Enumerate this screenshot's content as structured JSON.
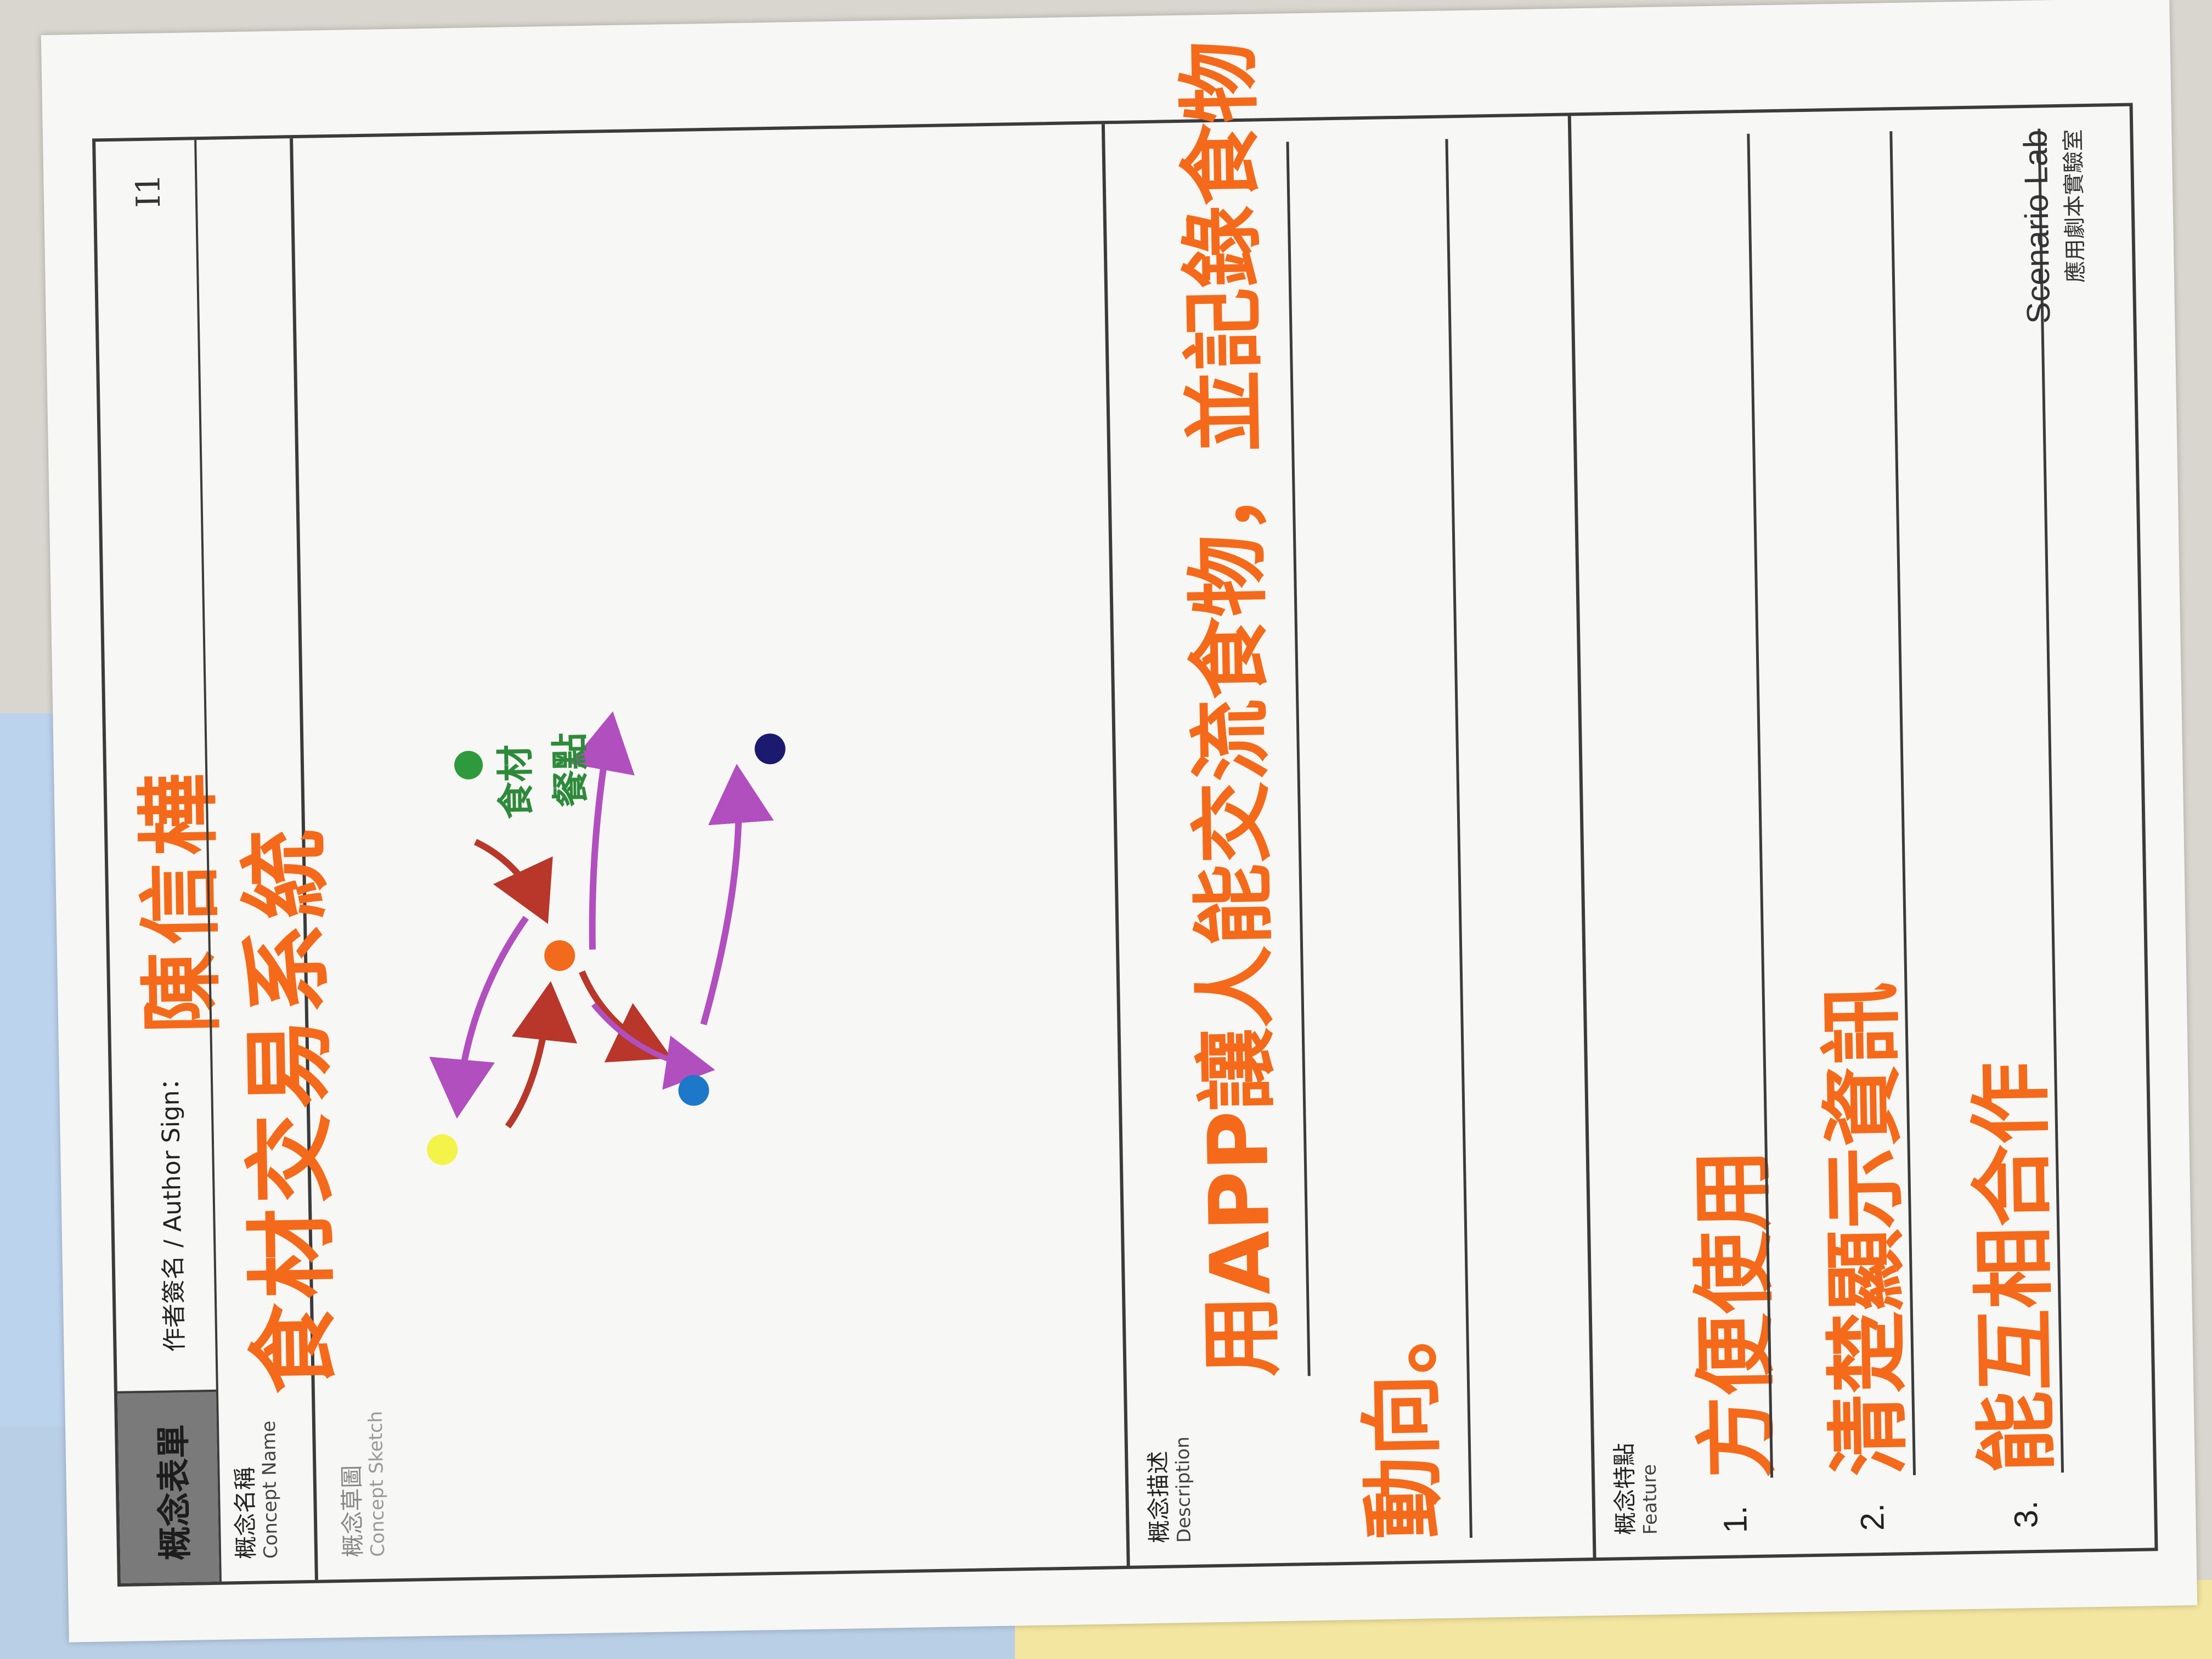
{
  "form": {
    "title": "概念表單",
    "author_label": "作者簽名 / Author Sign：",
    "author_name": "陳信樺",
    "page_code": "I1"
  },
  "concept_name": {
    "label_zh": "概念名稱",
    "label_en": "Concept Name",
    "value": "食材交易系統"
  },
  "sketch": {
    "label_zh": "概念草圖",
    "label_en": "Concept Sketch",
    "note_ingredients": "食材",
    "note_meeting_point": "餐點"
  },
  "description": {
    "label_zh": "概念描述",
    "label_en": "Description",
    "line1": "用APP讓人能交流食物，並記錄食物",
    "line2": "動向。"
  },
  "features": {
    "label_zh": "概念特點",
    "label_en": "Feature",
    "items": [
      {
        "num": "1.",
        "text": "方便使用"
      },
      {
        "num": "2.",
        "text": "清楚顯示資訊"
      },
      {
        "num": "3.",
        "text": "能互相合作"
      }
    ]
  },
  "brand": {
    "name": "Scenario Lab",
    "subtitle": "應用劇本實驗室"
  },
  "colors": {
    "ink_orange": "#f46a1a",
    "dot_orange": "#f26a1b",
    "dot_green": "#2e9a3c",
    "dot_yellow": "#f4f34a",
    "dot_blue": "#1e78c9",
    "dot_navy": "#1b1a6e",
    "arrow_red": "#b8372a",
    "arrow_purple": "#b14fbf",
    "note_green": "#2e8a3a"
  }
}
